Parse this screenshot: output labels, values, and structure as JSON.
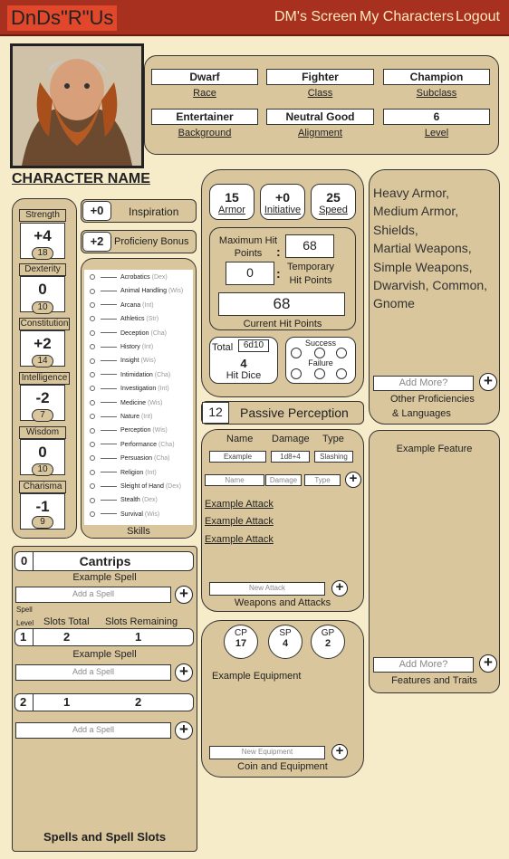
{
  "nav": {
    "brand": "DnDs\"R\"Us",
    "links": [
      "DM's Screen",
      "My Characters",
      "Logout"
    ]
  },
  "character": {
    "name_label": "CHARACTER NAME",
    "info": [
      {
        "value": "Dwarf",
        "label": "Race"
      },
      {
        "value": "Fighter",
        "label": "Class"
      },
      {
        "value": "Champion",
        "label": "Subclass"
      },
      {
        "value": "Entertainer",
        "label": "Background"
      },
      {
        "value": "Neutral Good",
        "label": "Alignment"
      },
      {
        "value": "6",
        "label": "Level"
      }
    ]
  },
  "stats": [
    {
      "name": "Strength",
      "mod": "+4",
      "score": "18"
    },
    {
      "name": "Dexterity",
      "mod": "0",
      "score": "10"
    },
    {
      "name": "Constitution",
      "mod": "+2",
      "score": "14"
    },
    {
      "name": "Intelligence",
      "mod": "-2",
      "score": "7"
    },
    {
      "name": "Wisdom",
      "mod": "0",
      "score": "10"
    },
    {
      "name": "Charisma",
      "mod": "-1",
      "score": "9"
    }
  ],
  "inspiration": {
    "value": "+0",
    "label": "Inspiration"
  },
  "proficiency": {
    "value": "+2",
    "label": "Proficieny Bonus"
  },
  "skills": {
    "title": "Skills",
    "items": [
      {
        "name": "Acrobatics",
        "ab": "(Dex)"
      },
      {
        "name": "Animal Handling",
        "ab": "(Wis)"
      },
      {
        "name": "Arcana",
        "ab": "(Int)"
      },
      {
        "name": "Athletics",
        "ab": "(Str)"
      },
      {
        "name": "Deception",
        "ab": "(Cha)"
      },
      {
        "name": "History",
        "ab": "(Int)"
      },
      {
        "name": "Insight",
        "ab": "(Wis)"
      },
      {
        "name": "Intimidation",
        "ab": "(Cha)"
      },
      {
        "name": "Investigation",
        "ab": "(Int)"
      },
      {
        "name": "Medicine",
        "ab": "(Wis)"
      },
      {
        "name": "Nature",
        "ab": "(Int)"
      },
      {
        "name": "Perception",
        "ab": "(Wis)"
      },
      {
        "name": "Performance",
        "ab": "(Cha)"
      },
      {
        "name": "Persuasion",
        "ab": "(Cha)"
      },
      {
        "name": "Religion",
        "ab": "(Int)"
      },
      {
        "name": "Sleight of Hand",
        "ab": "(Dex)"
      },
      {
        "name": "Stealth",
        "ab": "(Dex)"
      },
      {
        "name": "Survival",
        "ab": "(Wis)"
      }
    ]
  },
  "combat": {
    "armor": {
      "value": "15",
      "label": "Armor"
    },
    "initiative": {
      "value": "+0",
      "label": "Initiative"
    },
    "speed": {
      "value": "25",
      "label": "Speed"
    },
    "max_hp_label": "Maximum Hit Points",
    "max_hp": "68",
    "temp_hp": "0",
    "temp_hp_label": "Temporary Hit Points",
    "current_hp": "68",
    "current_hp_label": "Current Hit Points",
    "hit_dice": {
      "total_label": "Total",
      "total": "6d10",
      "value": "4",
      "label": "Hit Dice"
    },
    "death_saves": {
      "success": "Success",
      "failure": "Failure"
    }
  },
  "passive_perception": {
    "value": "12",
    "label": "Passive Perception"
  },
  "attacks": {
    "headers": [
      "Name",
      "Damage",
      "Type"
    ],
    "example": {
      "name": "Example",
      "damage": "1d8+4",
      "type": "Slashing"
    },
    "placeholders": {
      "name": "Name",
      "damage": "Damage",
      "type": "Type"
    },
    "list": [
      "Example Attack",
      "Example Attack",
      "Example Attack"
    ],
    "new_placeholder": "New Attack",
    "title": "Weapons and Attacks"
  },
  "equipment": {
    "coins": [
      {
        "label": "CP",
        "value": "17"
      },
      {
        "label": "SP",
        "value": "4"
      },
      {
        "label": "GP",
        "value": "2"
      }
    ],
    "item": "Example Equipment",
    "new_placeholder": "New Equipment",
    "title": "Coin and Equipment"
  },
  "proficiencies": {
    "text": [
      "Heavy Armor,",
      "Medium Armor,",
      "Shields,",
      "Martial Weapons,",
      "Simple Weapons,",
      "Dwarvish, Common,",
      "Gnome"
    ],
    "add_placeholder": "Add More?",
    "title_line1": "Other Proficiencies",
    "title_line2": "& Languages"
  },
  "features": {
    "item": "Example Feature",
    "add_placeholder": "Add More?",
    "title": "Features and Traits"
  },
  "spells": {
    "cantrips": {
      "level": "0",
      "label": "Cantrips",
      "spell": "Example Spell",
      "add_placeholder": "Add a Spell"
    },
    "col_spell": "Spell",
    "col_level": "Level",
    "col_total": "Slots Total",
    "col_remaining": "Slots Remaining",
    "levels": [
      {
        "level": "1",
        "total": "2",
        "remaining": "1",
        "spell": "Example Spell",
        "add_placeholder": "Add a Spell"
      },
      {
        "level": "2",
        "total": "1",
        "remaining": "2",
        "add_placeholder": "Add a Spell"
      }
    ],
    "title": "Spells and Spell Slots"
  },
  "colors": {
    "topbar": "#a7311e",
    "brand_bg": "#e0472b",
    "page_bg": "#f7ecc9",
    "panel_bg": "#d9c69c"
  }
}
